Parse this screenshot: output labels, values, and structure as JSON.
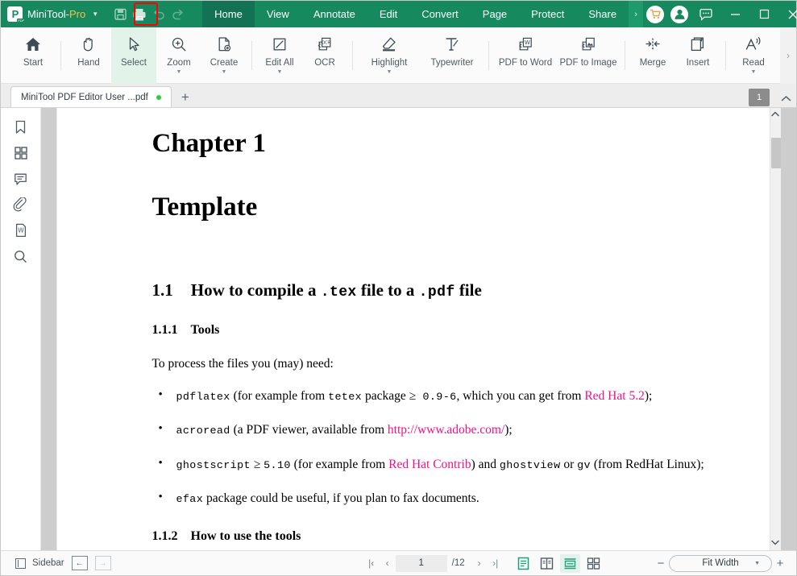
{
  "titlebar": {
    "brand_name": "MiniTool-",
    "brand_suffix": "Pro",
    "icons": {
      "save": "save-icon",
      "print": "print-icon",
      "undo": "undo-icon",
      "redo": "redo-icon",
      "cart": "cart-icon",
      "account": "account-icon",
      "feedback": "feedback-icon"
    },
    "menu": [
      {
        "label": "Home",
        "active": true
      },
      {
        "label": "View",
        "active": false
      },
      {
        "label": "Annotate",
        "active": false
      },
      {
        "label": "Edit",
        "active": false
      },
      {
        "label": "Convert",
        "active": false
      },
      {
        "label": "Page",
        "active": false
      },
      {
        "label": "Protect",
        "active": false
      },
      {
        "label": "Share",
        "active": false
      }
    ],
    "menu_overflow": "›",
    "window": {
      "minimize": "−",
      "maximize": "□",
      "close": "✕"
    }
  },
  "ribbon": {
    "items": [
      {
        "label": "Start",
        "icon": "home-icon",
        "caret": false,
        "selected": false
      },
      {
        "label": "Hand",
        "icon": "hand-icon",
        "caret": false,
        "selected": false
      },
      {
        "label": "Select",
        "icon": "cursor-icon",
        "caret": false,
        "selected": true
      },
      {
        "label": "Zoom",
        "icon": "zoom-in-icon",
        "caret": true,
        "selected": false
      },
      {
        "label": "Create",
        "icon": "create-file-icon",
        "caret": true,
        "selected": false
      },
      {
        "label": "Edit All",
        "icon": "edit-all-icon",
        "caret": true,
        "selected": false
      },
      {
        "label": "OCR",
        "icon": "ocr-icon",
        "caret": false,
        "selected": false
      },
      {
        "label": "Highlight",
        "icon": "highlighter-icon",
        "caret": true,
        "selected": false
      },
      {
        "label": "Typewriter",
        "icon": "typewriter-icon",
        "caret": false,
        "selected": false
      },
      {
        "label": "PDF to Word",
        "icon": "pdf-to-word-icon",
        "caret": false,
        "selected": false
      },
      {
        "label": "PDF to Image",
        "icon": "pdf-to-image-icon",
        "caret": false,
        "selected": false
      },
      {
        "label": "Merge",
        "icon": "merge-icon",
        "caret": false,
        "selected": false
      },
      {
        "label": "Insert",
        "icon": "insert-page-icon",
        "caret": false,
        "selected": false
      },
      {
        "label": "Read",
        "icon": "read-aloud-icon",
        "caret": true,
        "selected": false
      }
    ],
    "overflow": "›"
  },
  "tabstrip": {
    "tab_label": "MiniTool PDF Editor User ...pdf",
    "new_tab": "+",
    "page_badge": "1",
    "collapse": "⌃"
  },
  "sidebar": {
    "items": [
      {
        "name": "bookmark-icon"
      },
      {
        "name": "thumbnails-icon"
      },
      {
        "name": "comment-icon"
      },
      {
        "name": "attachment-icon"
      },
      {
        "name": "word-export-icon"
      },
      {
        "name": "search-icon"
      }
    ]
  },
  "document": {
    "chapter": "Chapter 1",
    "title": "Template",
    "section": {
      "num": "1.1",
      "text_a": "How to compile a ",
      "mono_a": ".tex",
      "text_b": " file to a ",
      "mono_b": ".pdf",
      "text_c": " file"
    },
    "subsection": {
      "num": "1.1.1",
      "label": "Tools"
    },
    "intro": "To process the files you (may) need:",
    "bullets": [
      {
        "parts": [
          {
            "t": "pdflatex",
            "s": "mono"
          },
          {
            "t": " (for example from ",
            "s": "plain"
          },
          {
            "t": "tetex",
            "s": "mono"
          },
          {
            "t": " package ",
            "s": "plain"
          },
          {
            "t": "≥",
            "s": "plain"
          },
          {
            "t": " 0.9-6",
            "s": "mono"
          },
          {
            "t": ", which you can get from ",
            "s": "plain"
          },
          {
            "t": "Red Hat 5.2",
            "s": "pink"
          },
          {
            "t": ");",
            "s": "plain"
          }
        ]
      },
      {
        "parts": [
          {
            "t": "acroread",
            "s": "mono"
          },
          {
            "t": " (a PDF viewer, available from ",
            "s": "plain"
          },
          {
            "t": "http://www.adobe.com/",
            "s": "pink"
          },
          {
            "t": ");",
            "s": "plain"
          }
        ]
      },
      {
        "parts": [
          {
            "t": "ghostscript",
            "s": "mono"
          },
          {
            "t": " ≥ ",
            "s": "plain"
          },
          {
            "t": "5.10",
            "s": "mono"
          },
          {
            "t": " (for example from ",
            "s": "plain"
          },
          {
            "t": "Red Hat Contrib",
            "s": "pink"
          },
          {
            "t": ") and ",
            "s": "plain"
          },
          {
            "t": "ghostview",
            "s": "mono"
          },
          {
            "t": " or ",
            "s": "plain"
          },
          {
            "t": "gv",
            "s": "mono"
          },
          {
            "t": " (from RedHat Linux);",
            "s": "plain"
          }
        ]
      },
      {
        "parts": [
          {
            "t": "efax",
            "s": "mono"
          },
          {
            "t": " package could be useful, if you plan to fax documents.",
            "s": "plain"
          }
        ]
      }
    ],
    "subsection2": {
      "num": "1.1.2",
      "label": "How to use the tools"
    }
  },
  "statusbar": {
    "sidebar_label": "Sidebar",
    "back_arrow": "←",
    "forward_arrow": "→",
    "first_page": "|‹",
    "prev_page": "‹",
    "current_page": "1",
    "total_pages": "/12",
    "next_page": "›",
    "last_page": "›|",
    "view_modes": [
      {
        "name": "single-page-view",
        "active": true
      },
      {
        "name": "two-page-view",
        "active": false
      },
      {
        "name": "continuous-scroll-view",
        "active": true
      },
      {
        "name": "grid-view",
        "active": false
      }
    ],
    "zoom_out": "−",
    "zoom_level": "Fit Width",
    "zoom_caret": "▼",
    "zoom_in": "+"
  },
  "colors": {
    "brand_green": "#16895f",
    "accent_teal": "#1aa179",
    "highlight_red": "#ff0000",
    "link_pink": "#ee1289",
    "badge_gray": "#8c8c8c"
  }
}
